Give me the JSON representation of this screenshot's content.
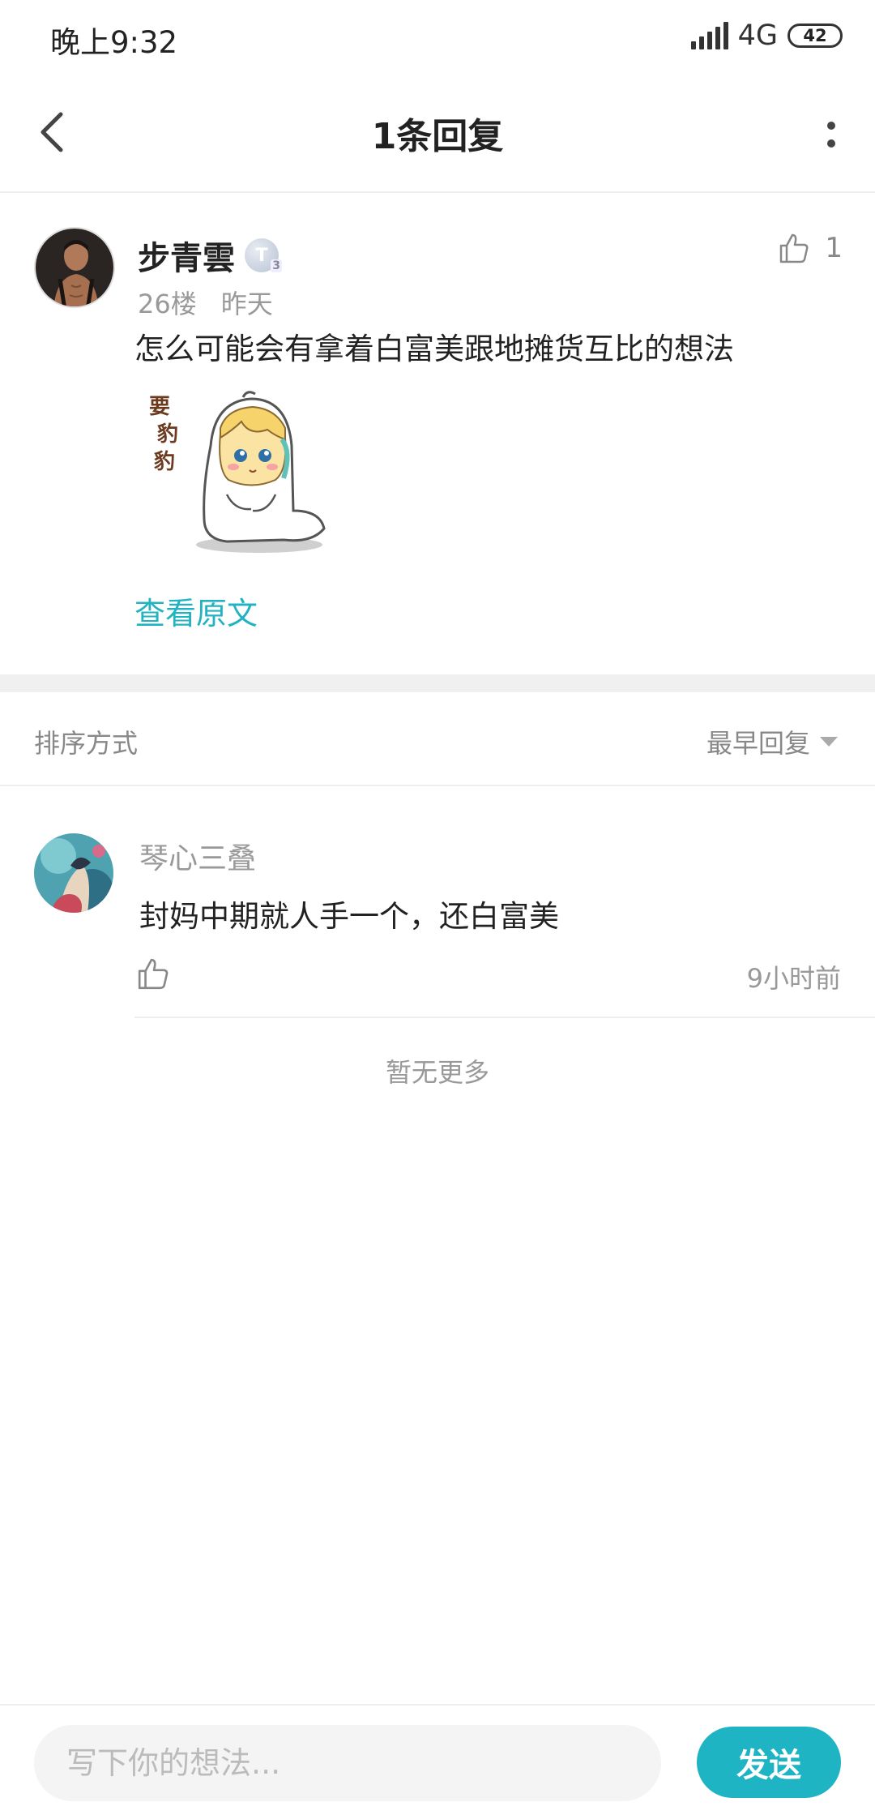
{
  "status_bar": {
    "time": "晚上9:32",
    "network": "4G",
    "battery": "42"
  },
  "header": {
    "title": "1条回复",
    "back_icon": "chevron-left-icon",
    "more_icon": "more-vertical-icon"
  },
  "main_comment": {
    "author": "步青雲",
    "level_badge": "T",
    "level_sub": "3",
    "floor": "26楼",
    "time": "昨天",
    "text": "怎么可能会有拿着白富美跟地摊货互比的想法",
    "like_count": "1",
    "sticker_text": "要豹豹",
    "view_original": "查看原文"
  },
  "sort": {
    "label": "排序方式",
    "selected": "最早回复"
  },
  "replies": [
    {
      "author": "琴心三叠",
      "text": "封妈中期就人手一个，还白富美",
      "time": "9小时前"
    }
  ],
  "no_more": "暂无更多",
  "composer": {
    "placeholder": "写下你的想法...",
    "send_label": "发送"
  },
  "colors": {
    "accent": "#1fb4c4",
    "link": "#21b3c2"
  }
}
